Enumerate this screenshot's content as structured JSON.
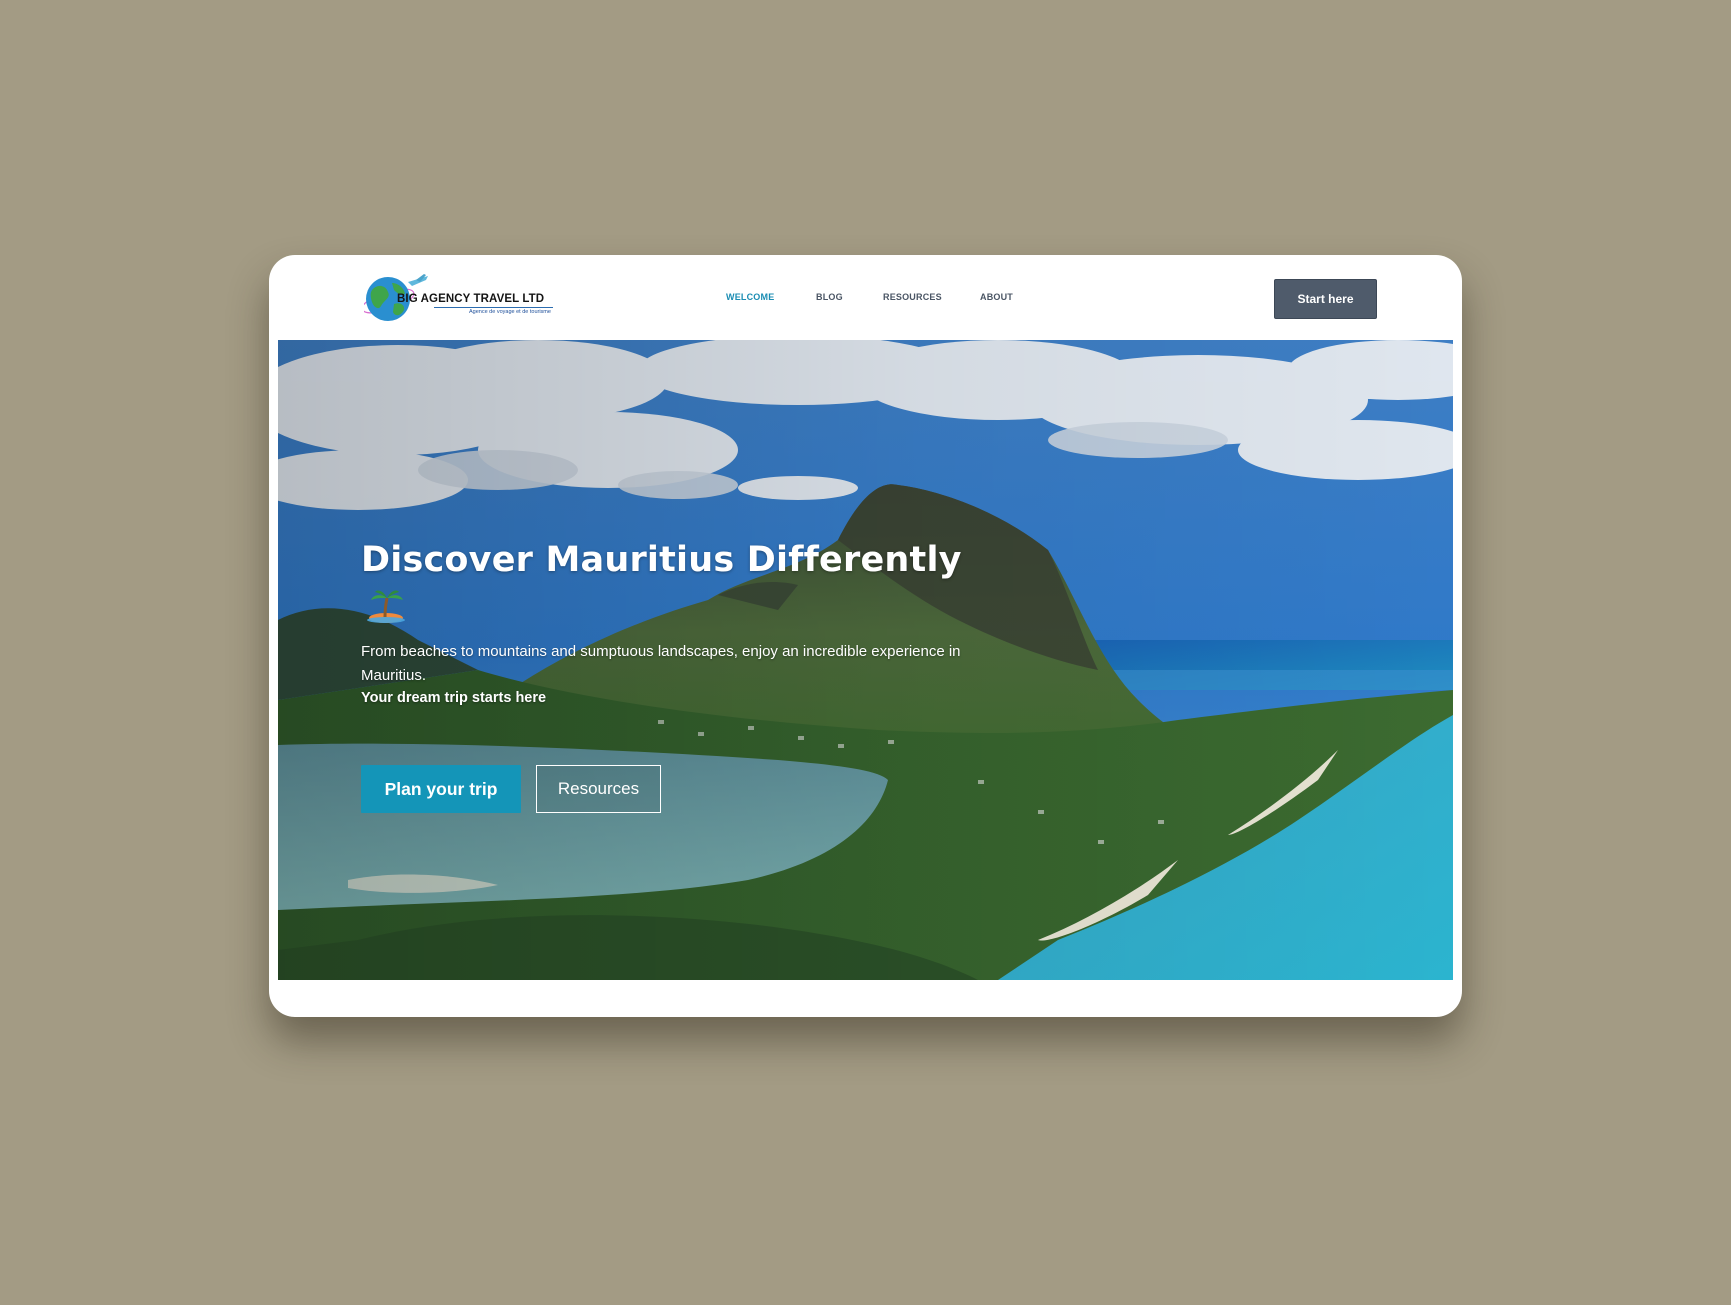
{
  "brand": {
    "name": "BIG AGENCY TRAVEL LTD",
    "tagline": "Agence de voyage et de tourisme"
  },
  "nav": {
    "items": [
      {
        "label": "WELCOME",
        "active": true
      },
      {
        "label": "BLOG",
        "active": false
      },
      {
        "label": "RESOURCES",
        "active": false
      },
      {
        "label": "ABOUT",
        "active": false
      }
    ],
    "cta_label": "Start here"
  },
  "hero": {
    "title": "Discover Mauritius Differently",
    "emoji": "palm-island-icon",
    "description": "From beaches to mountains and sumptuous landscapes, enjoy an incredible experience in Mauritius.",
    "tagline": "Your dream trip starts here",
    "primary_button": "Plan your trip",
    "secondary_button": "Resources"
  },
  "colors": {
    "page_background": "#a39b84",
    "accent": "#1495b8",
    "nav_active": "#1b8db3",
    "cta_background": "#4f5b6b"
  }
}
